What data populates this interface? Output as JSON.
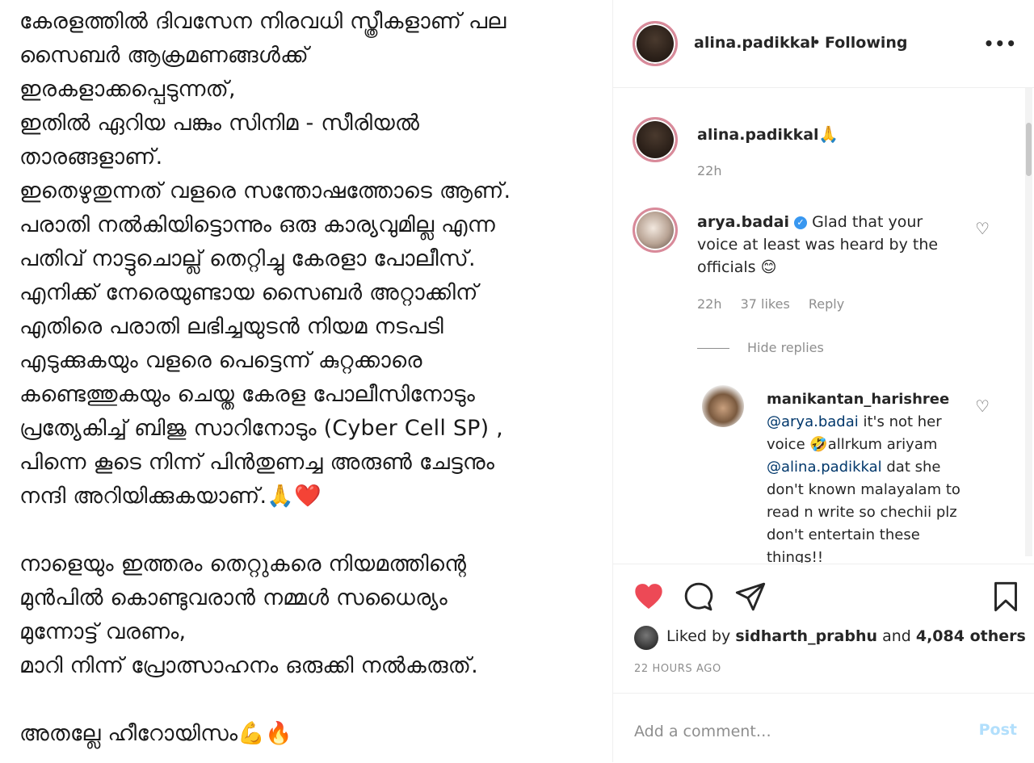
{
  "post": {
    "lines": [
      "കേരളത്തിൽ ദിവസേന നിരവധി സ്ത്രീകളാണ് പല",
      "സൈബർ ആക്രമണങ്ങൾക്ക്",
      "ഇരകളാക്കപ്പെടുന്നത്,",
      "ഇതിൽ ഏറിയ പങ്കും സിനിമ - സീരിയൽ",
      "താരങ്ങളാണ്.",
      "ഇതെഴുതുന്നത് വളരെ സന്തോഷത്തോടെ ആണ്.",
      "പരാതി നൽകിയിട്ടൊന്നും ഒരു കാര്യവുമില്ല എന്ന",
      "പതിവ് നാട്ടുചൊല്ല് തെറ്റിച്ചു കേരളാ പോലീസ്.",
      "എനിക്ക് നേരെയുണ്ടായ സൈബർ അറ്റാക്കിന്",
      "എതിരെ പരാതി ലഭിച്ചയുടൻ നിയമ നടപടി",
      "എടുക്കുകയും വളരെ പെട്ടെന്ന് കുറ്റക്കാരെ",
      "കണ്ടെത്തുകയും ചെയ്ത കേരള പോലീസിനോടും",
      "പ്രത്യേകിച്ച് ബിജു സാറിനോടും (Cyber Cell SP) ,",
      "പിന്നെ കൂടെ നിന്ന് പിൻതുണച്ച അരുൺ ചേട്ടനും",
      "നന്ദി  അറിയിക്കുകയാണ്.🙏❤️",
      "",
      "നാളെയും ഇത്തരം തെറ്റുകരെ നിയമത്തിന്റെ",
      "മുൻപിൽ കൊണ്ടുവരാൻ നമ്മൾ സധൈര്യം",
      "മുന്നോട്ട് വരണം,",
      "മാറി നിന്ന് പ്രോത്സാഹനം ഒരുക്കി നൽകരുത്.",
      "",
      "അതല്ലേ ഹീറോയിസം💪🔥"
    ]
  },
  "header": {
    "username": "alina.padikkal",
    "separator": "•",
    "follow_status": "Following",
    "more": "•••"
  },
  "caption": {
    "username": "alina.padikkal",
    "emoji": "🙏",
    "time": "22h"
  },
  "comments": [
    {
      "username": "arya.badai",
      "verified": true,
      "text": "Glad that your voice at least was heard by the officials 😊",
      "time": "22h",
      "likes": "37 likes",
      "reply": "Reply",
      "hide_replies": "Hide replies"
    },
    {
      "username": "manikantan_harishree",
      "mention1": "@arya.badai",
      "text1": " it's not her voice 🤣allrkum ariyam ",
      "mention2": "@alina.padikkal",
      "text2": " dat she don't known malayalam to read n write so chechii plz don't entertain these things!!"
    }
  ],
  "actions": {
    "liked_by_prefix": "Liked by ",
    "liked_by_user": "sidharth_prabhu",
    "liked_by_middle": " and ",
    "liked_by_count": "4,084 others",
    "timestamp": "22 HOURS AGO"
  },
  "add_comment": {
    "placeholder": "Add a comment…",
    "post_label": "Post"
  },
  "colors": {
    "like_red": "#ed4956",
    "link_blue": "#00376b",
    "verified_blue": "#3897f0",
    "post_disabled": "#b2dffc"
  }
}
